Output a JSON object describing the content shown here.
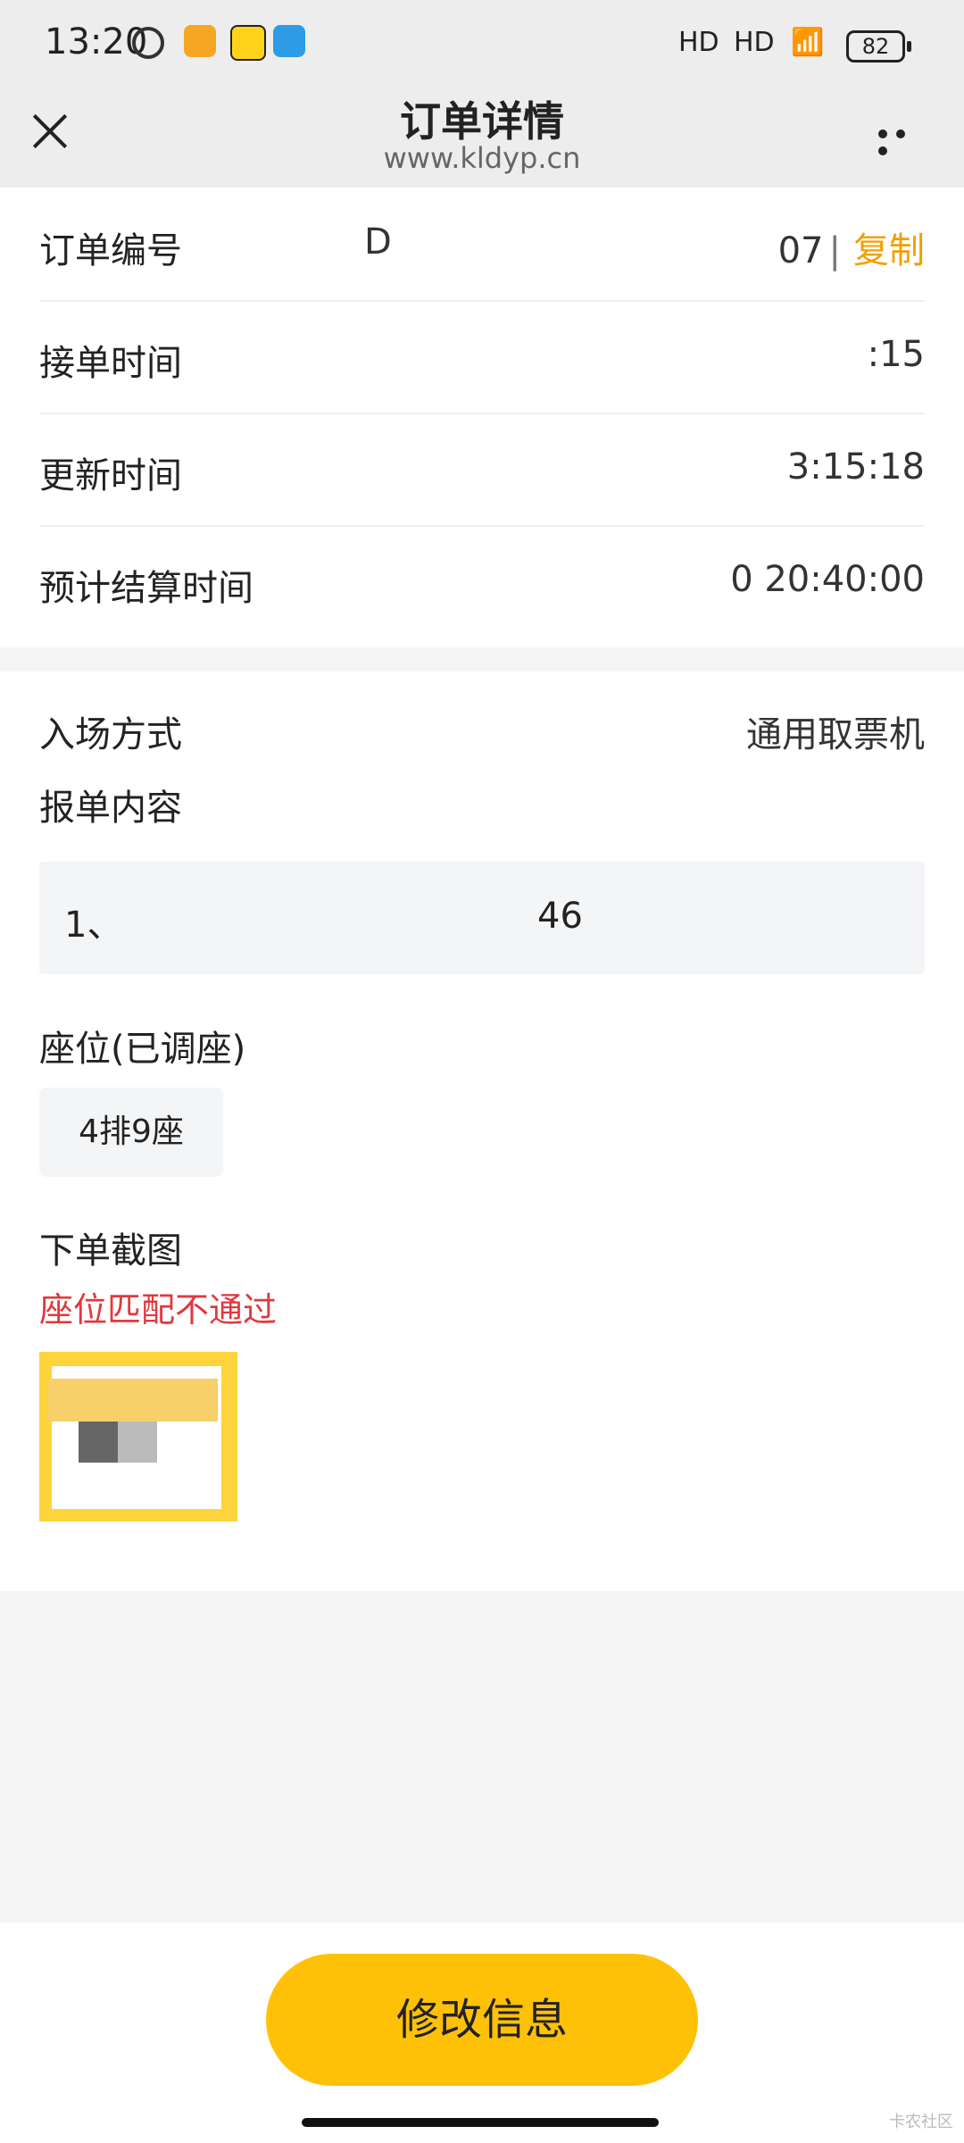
{
  "status_bar": {
    "time": "13:20",
    "signal1": "HD",
    "signal2": "HD",
    "battery": "82",
    "icons": [
      "alarm-icon",
      "app-icon-orange",
      "app-icon-yellow",
      "app-icon-blue"
    ]
  },
  "nav": {
    "title": "订单详情",
    "subtitle": "www.kldyp.cn",
    "close_icon": "close-icon",
    "more_icon": "more-icon"
  },
  "order": {
    "order_no_label": "订单编号",
    "order_no_prefix": "D",
    "order_no_suffix": "07",
    "copy_label": "复制",
    "accept_time_label": "接单时间",
    "accept_time_value": ":15",
    "update_time_label": "更新时间",
    "update_time_value": "3:15:18",
    "settle_time_label": "预计结算时间",
    "settle_time_value": "0 20:40:00"
  },
  "details": {
    "entry_label": "入场方式",
    "entry_value": "通用取票机",
    "report_label": "报单内容",
    "report_prefix": "1、",
    "report_value": "46",
    "seat_label": "座位(已调座)",
    "seat_value": "4排9座",
    "screenshot_label": "下单截图",
    "match_status": "座位匹配不通过"
  },
  "actions": {
    "edit_label": "修改信息"
  },
  "watermark": "卡农社区",
  "colors": {
    "accent": "#ffc107",
    "copy": "#f0a000",
    "error": "#e0393e"
  }
}
